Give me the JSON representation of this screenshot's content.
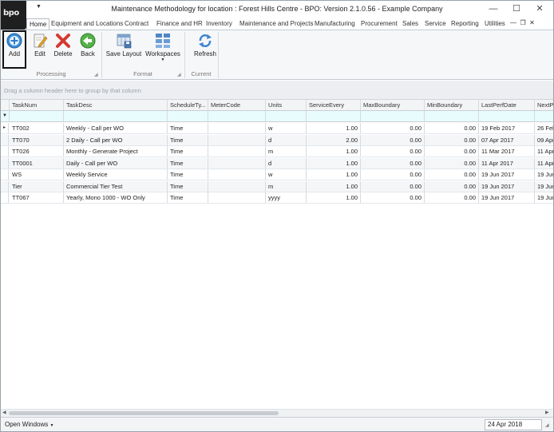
{
  "window": {
    "title": "Maintenance Methodology for location : Forest Hills Centre - BPO: Version 2.1.0.56 - Example Company",
    "logo_text": "bpo",
    "min_icon": "minimize-icon",
    "max_icon": "maximize-icon",
    "close_icon": "close-icon"
  },
  "tabs": [
    {
      "label": "Home",
      "active": true
    },
    {
      "label": "Equipment and Locations"
    },
    {
      "label": "Contract"
    },
    {
      "label": "Finance and HR"
    },
    {
      "label": "Inventory"
    },
    {
      "label": "Maintenance and Projects"
    },
    {
      "label": "Manufacturing"
    },
    {
      "label": "Procurement"
    },
    {
      "label": "Sales"
    },
    {
      "label": "Service"
    },
    {
      "label": "Reporting"
    },
    {
      "label": "Utilities"
    }
  ],
  "ribbon": {
    "buttons": {
      "add": "Add",
      "edit": "Edit",
      "delete": "Delete",
      "back": "Back",
      "save_layout": "Save Layout",
      "workspaces": "Workspaces",
      "refresh": "Refresh"
    },
    "groups": {
      "processing": "Processing",
      "format": "Format",
      "current": "Current"
    }
  },
  "grid": {
    "group_hint": "Drag a column header here to group by that column",
    "columns": [
      "TaskNum",
      "TaskDesc",
      "ScheduleTy...",
      "MeterCode",
      "Units",
      "ServiceEvery",
      "MaxBoundary",
      "MinBoundary",
      "LastPerfDate",
      "NextPe"
    ],
    "rows": [
      [
        "TT002",
        "Weekly - Call per WO",
        "Time",
        "",
        "w",
        "1.00",
        "0.00",
        "0.00",
        "19 Feb 2017",
        "26 Feb"
      ],
      [
        "TT070",
        "2 Daily - Call per WO",
        "Time",
        "",
        "d",
        "2.00",
        "0.00",
        "0.00",
        "07 Apr 2017",
        "09 Apr"
      ],
      [
        "TT026",
        "Monthly - Generate Project",
        "Time",
        "",
        "m",
        "1.00",
        "0.00",
        "0.00",
        "11 Mar 2017",
        "11 Apr"
      ],
      [
        "TT0001",
        "Daily - Call per WO",
        "Time",
        "",
        "d",
        "1.00",
        "0.00",
        "0.00",
        "11 Apr 2017",
        "11 Apr"
      ],
      [
        "WS",
        "Weekly Service",
        "Time",
        "",
        "w",
        "1.00",
        "0.00",
        "0.00",
        "19 Jun 2017",
        "19 Jun"
      ],
      [
        "Tier",
        "Commercial Tier Test",
        "Time",
        "",
        "m",
        "1.00",
        "0.00",
        "0.00",
        "19 Jun 2017",
        "19 Jun"
      ],
      [
        "TT067",
        "Yearly, Mono 1000 - WO Only",
        "Time",
        "",
        "yyyy",
        "1.00",
        "0.00",
        "0.00",
        "19 Jun 2017",
        "19 Jun"
      ]
    ]
  },
  "statusbar": {
    "open_windows": "Open Windows",
    "date": "24 Apr 2018"
  }
}
